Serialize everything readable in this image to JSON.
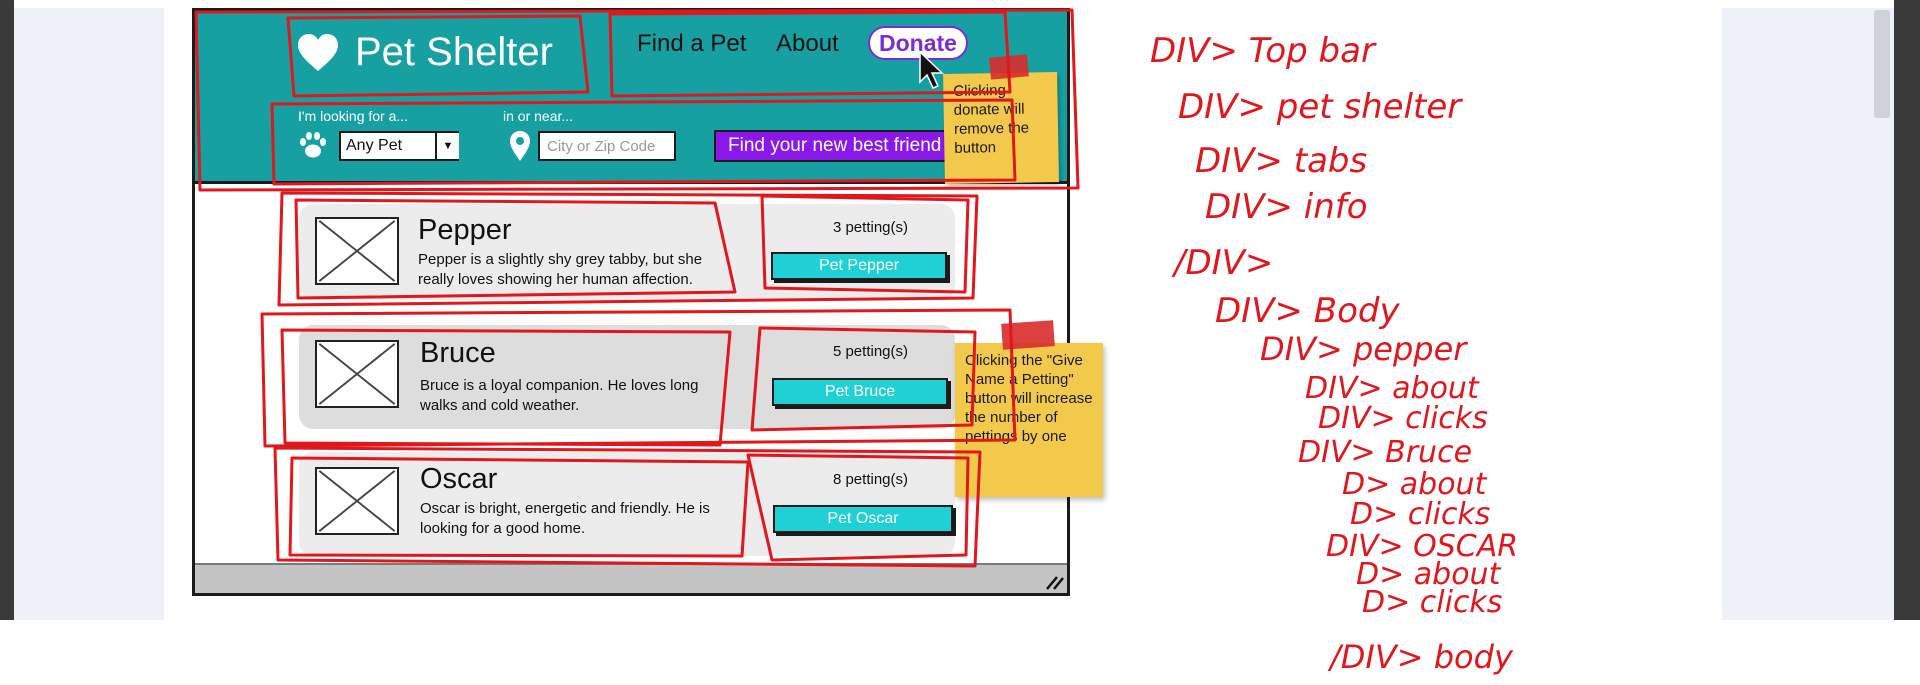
{
  "header": {
    "brand_title": "Pet Shelter",
    "nav": {
      "find_a_pet": "Find a Pet",
      "about": "About",
      "donate": "Donate"
    },
    "search": {
      "looking_for_label": "I'm looking for a...",
      "near_label": "in or near...",
      "pet_type_value": "Any Pet",
      "location_placeholder": "City or Zip Code",
      "submit_label": "Find your new best friend"
    }
  },
  "sticky_notes": {
    "donate_note": "Clicking donate will remove the button",
    "petting_note": "Clicking the \"Give Name a Petting\" button will increase the number of pettings by one"
  },
  "pets": [
    {
      "name": "Pepper",
      "description": "Pepper is a slightly shy grey tabby, but she really loves showing her human affection.",
      "count": "3 petting(s)",
      "button": "Pet Pepper"
    },
    {
      "name": "Bruce",
      "description": "Bruce is a loyal companion. He loves long walks and cold weather.",
      "count": "5 petting(s)",
      "button": "Pet Bruce"
    },
    {
      "name": "Oscar",
      "description": "Oscar is bright, energetic and friendly. He is looking for a good home.",
      "count": "8 petting(s)",
      "button": "Pet Oscar"
    }
  ],
  "annotations": [
    "DIV> Top bar",
    "DIV> pet shelter",
    "DIV> tabs",
    "DIV> info",
    "/DIV>",
    "DIV> Body",
    "DIV> pepper",
    "DIV> about",
    "DIV> clicks",
    "DIV> Bruce",
    "D> about",
    "D> clicks",
    "DIV> OSCAR",
    "D> about",
    "D> clicks",
    "/DIV> body"
  ],
  "colors": {
    "header_teal": "#17a0a2",
    "accent_purple": "#8a18ea",
    "button_cyan": "#1fd0d4",
    "sticky_yellow": "#f3c94c",
    "annotation_red": "#e0171d"
  }
}
